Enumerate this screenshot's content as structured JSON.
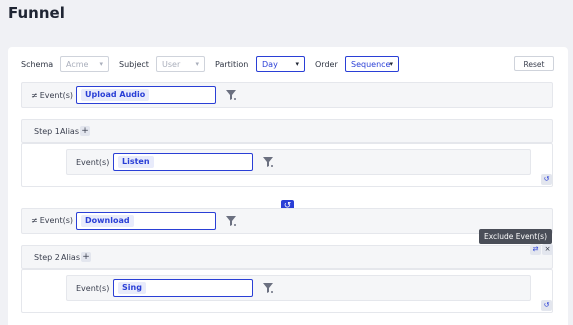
{
  "page": {
    "title": "Funnel"
  },
  "controls": {
    "schema_label": "Schema",
    "schema_value": "Acme",
    "subject_label": "Subject",
    "subject_value": "User",
    "partition_label": "Partition",
    "partition_value": "Day",
    "order_label": "Order",
    "order_value": "Sequence",
    "reset_label": "Reset"
  },
  "exclusions": [
    {
      "label": "Event(s)",
      "value": "Upload Audio"
    },
    {
      "label": "Event(s)",
      "value": "Download"
    }
  ],
  "steps": [
    {
      "step_label": "Step 1",
      "alias_label": "Alias",
      "event_label": "Event(s)",
      "event_value": "Listen"
    },
    {
      "step_label": "Step 2",
      "alias_label": "Alias",
      "event_label": "Event(s)",
      "event_value": "Sing"
    }
  ],
  "tooltip": {
    "text": "Exclude Event(s)"
  },
  "icons": {
    "neq": "≠",
    "plus": "+",
    "caret": "▾",
    "close": "×",
    "swap": "⇄",
    "loop": "↺"
  },
  "colors": {
    "accent": "#2a3fd6",
    "tooltip_bg": "#4a4e58"
  }
}
